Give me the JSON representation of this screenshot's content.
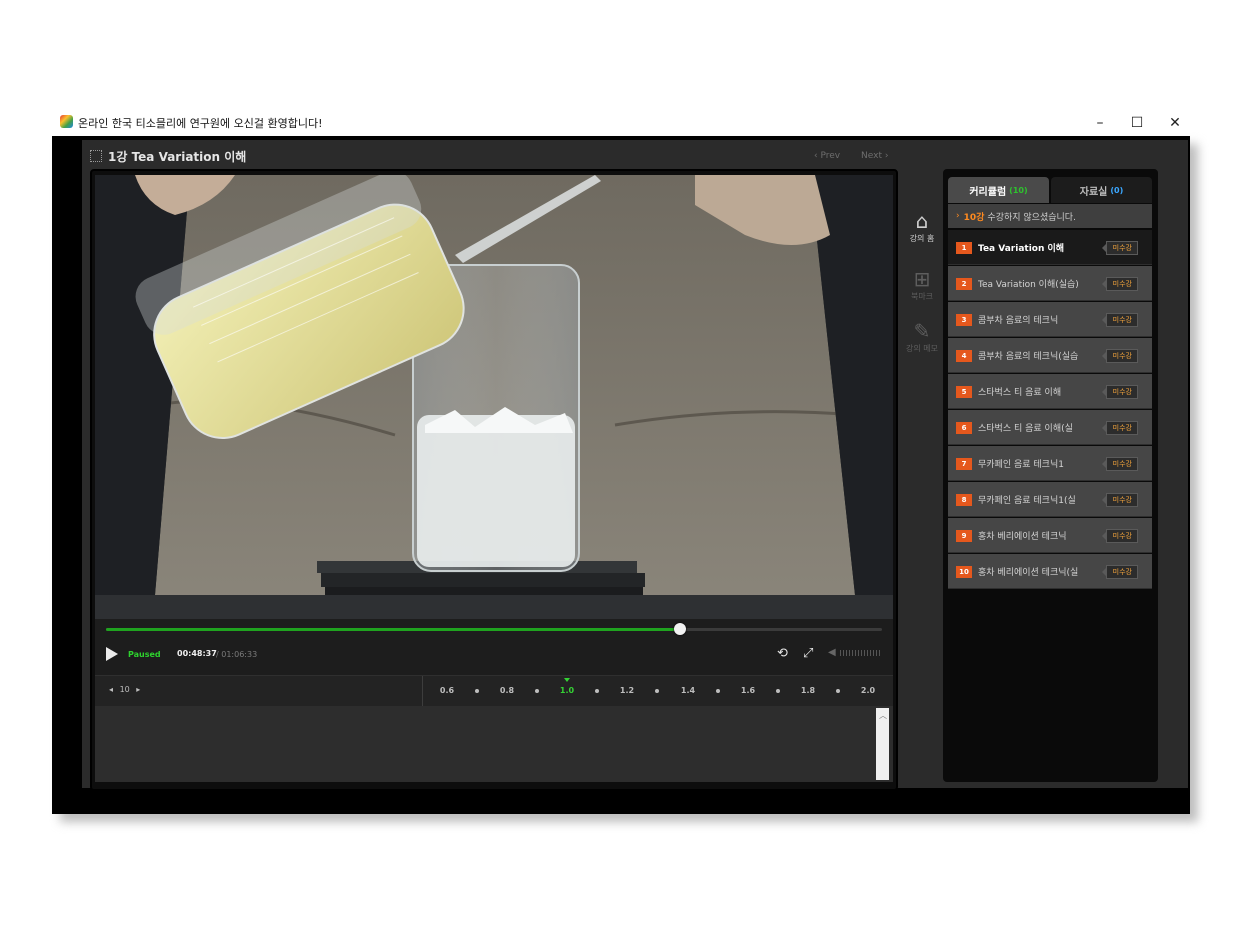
{
  "window": {
    "title": "온라인 한국 티소믈리에 연구원에 오신걸 환영합니다!",
    "minimize": "–",
    "maximize": "☐",
    "close": "✕"
  },
  "header": {
    "lecture_title": "1강  Tea Variation 이해",
    "prev_label": "‹ Prev",
    "next_label": "Next ›"
  },
  "player": {
    "status": "Paused",
    "current_time": "00:48:37",
    "total_time": "/ 01:06:33",
    "progress_fraction": 0.74,
    "seek_step": "10",
    "speeds": [
      "0.6",
      "0.8",
      "1.0",
      "1.2",
      "1.4",
      "1.6",
      "1.8",
      "2.0"
    ],
    "active_speed": "1.0",
    "accent_color": "#1fa31f"
  },
  "tools": [
    {
      "label": "강의 홈",
      "icon": "home-icon"
    },
    {
      "label": "북마크",
      "icon": "bookmark-add-icon"
    },
    {
      "label": "강의 메모",
      "icon": "memo-icon"
    }
  ],
  "panel": {
    "tab_curriculum": "커리큘럼",
    "tab_curriculum_count": "(10)",
    "tab_materials": "자료실",
    "tab_materials_count": "(0)",
    "notice_highlight": "10강",
    "notice_text": "수강하지 않으셨습니다.",
    "lessons": [
      {
        "num": "1",
        "title": "Tea Variation 이해",
        "badge": "미수강"
      },
      {
        "num": "2",
        "title": "Tea Variation 이해(실습)",
        "badge": "미수강"
      },
      {
        "num": "3",
        "title": "콤부차 음료의 테크닉",
        "badge": "미수강"
      },
      {
        "num": "4",
        "title": "콤부차 음료의 테크닉(실습",
        "badge": "미수강"
      },
      {
        "num": "5",
        "title": "스타벅스 티 음료 이해",
        "badge": "미수강"
      },
      {
        "num": "6",
        "title": "스타벅스 티 음료 이해(실",
        "badge": "미수강"
      },
      {
        "num": "7",
        "title": "무카페인 음료 테크닉1",
        "badge": "미수강"
      },
      {
        "num": "8",
        "title": "무카페인 음료 테크닉1(실",
        "badge": "미수강"
      },
      {
        "num": "9",
        "title": "홍차 베리에이션 테크닉",
        "badge": "미수강"
      },
      {
        "num": "10",
        "title": "홍차 베리에이션 테크닉(실",
        "badge": "미수강"
      }
    ]
  }
}
